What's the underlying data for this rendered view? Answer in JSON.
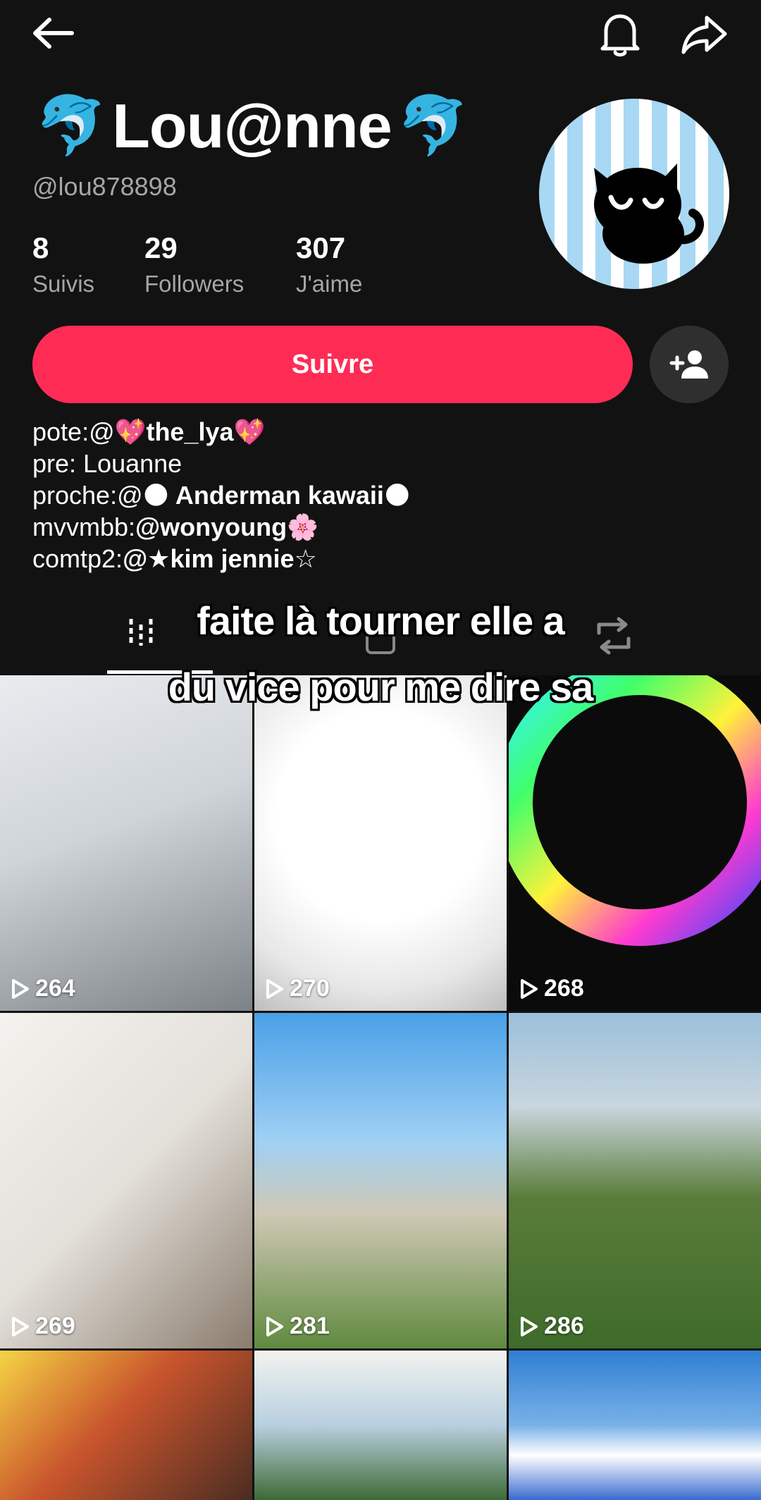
{
  "profile": {
    "display_name": "Lou@nne",
    "name_emoji": "🐬",
    "username": "@lou878898",
    "avatar_icon": "black-cat-on-blue-stripes"
  },
  "stats": {
    "following": {
      "value": "8",
      "label": "Suivis"
    },
    "followers": {
      "value": "29",
      "label": "Followers"
    },
    "likes": {
      "value": "307",
      "label": "J'aime"
    }
  },
  "actions": {
    "follow_label": "Suivre",
    "add_friend_icon": "add-user-icon"
  },
  "bio": {
    "line1_prefix": "pote:@",
    "line1_emoji_left": "💖",
    "line1_handle": "the_lya",
    "line1_emoji_right": "💖",
    "line2": "pre: Louanne",
    "line3_prefix": "proche:@",
    "line3_emoji": "🌑",
    "line3_handle": " Anderman kawaii",
    "line3_emoji_end": "🌑",
    "line4_prefix": "mvvmbb:",
    "line4_handle": "@wonyoung",
    "line4_emoji": "🌸",
    "line5_prefix": "comtp2:",
    "line5_handle": "@★kim jennie☆"
  },
  "caption": {
    "line1": "faite là tourner elle a",
    "line2": "du vice pour me dire sa"
  },
  "tabs": [
    "videos-grid-icon",
    "locked-icon",
    "repost-icon"
  ],
  "videos": [
    {
      "views": "264"
    },
    {
      "views": "270"
    },
    {
      "views": "268"
    },
    {
      "views": "269"
    },
    {
      "views": "281"
    },
    {
      "views": "286"
    },
    {
      "views": ""
    },
    {
      "views": ""
    },
    {
      "views": ""
    }
  ],
  "colors": {
    "background": "#121212",
    "follow_button": "#fe2c55",
    "secondary_text": "#a6a6a6"
  }
}
